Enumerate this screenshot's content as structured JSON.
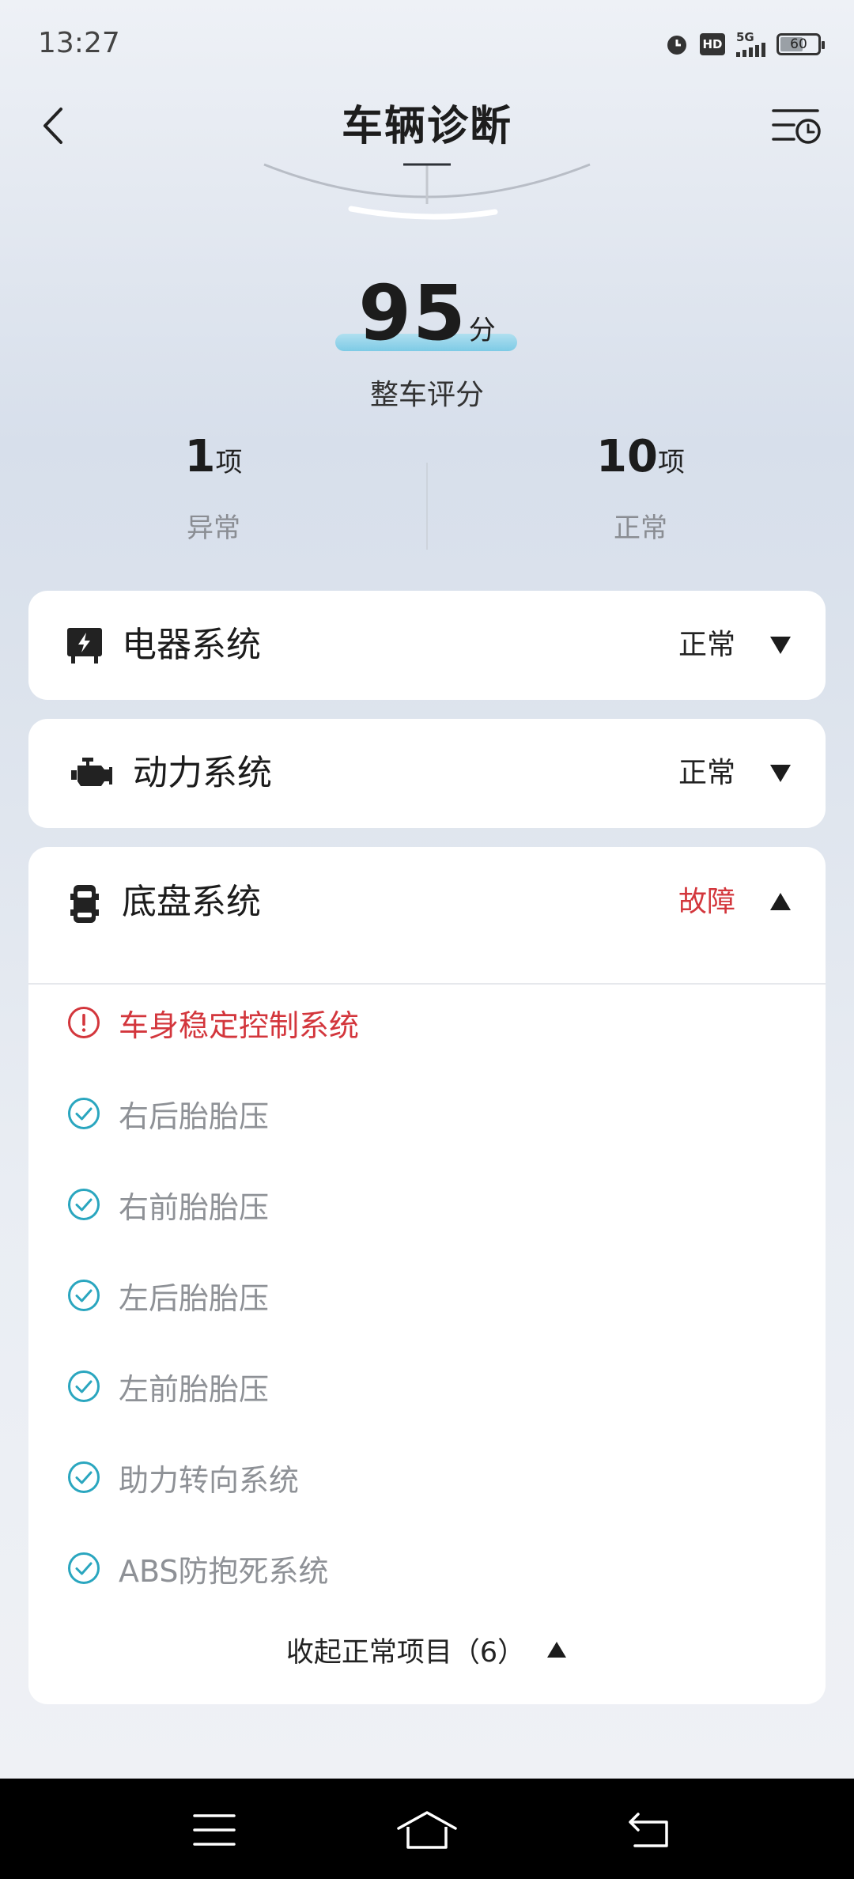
{
  "status_bar": {
    "time": "13:27",
    "hd_label": "HD",
    "network": "5G",
    "battery_level": "60",
    "battery_fraction": 0.6
  },
  "header": {
    "title": "车辆诊断"
  },
  "score": {
    "value": "95",
    "unit": "分",
    "label": "整车评分"
  },
  "stats": {
    "abnormal": {
      "count": "1",
      "unit": "项",
      "label": "异常"
    },
    "normal": {
      "count": "10",
      "unit": "项",
      "label": "正常"
    }
  },
  "systems": [
    {
      "name": "电器系统",
      "status": "正常",
      "icon": "electric-system-icon",
      "expanded": false
    },
    {
      "name": "动力系统",
      "status": "正常",
      "icon": "engine-icon",
      "expanded": false
    },
    {
      "name": "底盘系统",
      "status": "故障",
      "icon": "chassis-icon",
      "expanded": true
    }
  ],
  "chassis_items": [
    {
      "label": "车身稳定控制系统",
      "state": "fault"
    },
    {
      "label": "右后胎胎压",
      "state": "ok"
    },
    {
      "label": "右前胎胎压",
      "state": "ok"
    },
    {
      "label": "左后胎胎压",
      "state": "ok"
    },
    {
      "label": "左前胎胎压",
      "state": "ok"
    },
    {
      "label": "助力转向系统",
      "state": "ok"
    },
    {
      "label": "ABS防抱死系统",
      "state": "ok"
    }
  ],
  "collapse_label": "收起正常项目（6）",
  "colors": {
    "fault": "#d3363c",
    "ok": "#2aa6bf",
    "text": "#1c1c1c",
    "muted": "#8e9196"
  }
}
